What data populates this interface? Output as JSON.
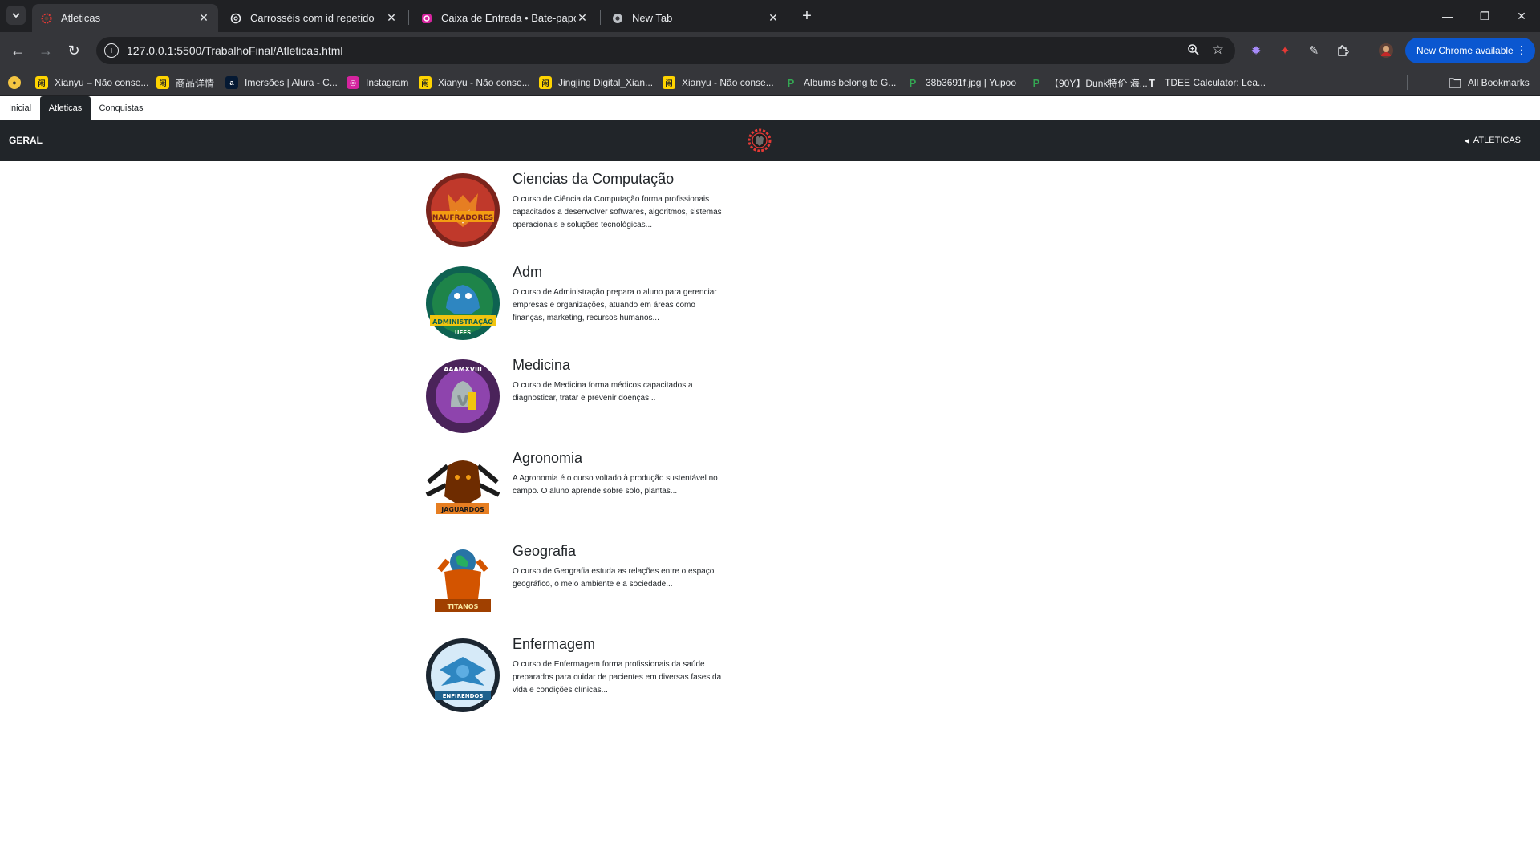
{
  "browser": {
    "tabs": [
      {
        "title": "Atleticas",
        "active": true,
        "icon": "atletica-favicon"
      },
      {
        "title": "Carrosséis com id repetido",
        "active": false,
        "icon": "openai-icon"
      },
      {
        "title": "Caixa de Entrada • Bate-papos",
        "active": false,
        "icon": "instagram-icon"
      },
      {
        "title": "New Tab",
        "active": false,
        "icon": "chrome-icon"
      }
    ],
    "url": "127.0.0.1:5500/TrabalhoFinal/Atleticas.html",
    "update_button": "New Chrome available",
    "bookmarks": [
      {
        "label": "",
        "icon": "bookmark-ufo-icon"
      },
      {
        "label": "Xianyu – Não conse...",
        "icon": "xianyu-icon"
      },
      {
        "label": "商品详情",
        "icon": "xianyu-icon"
      },
      {
        "label": "Imersões | Alura - C...",
        "icon": "alura-icon"
      },
      {
        "label": "Instagram",
        "icon": "instagram-icon"
      },
      {
        "label": "Xianyu - Não conse...",
        "icon": "xianyu-icon"
      },
      {
        "label": "Jingjing Digital_Xian...",
        "icon": "xianyu-icon"
      },
      {
        "label": "Xianyu - Não conse...",
        "icon": "xianyu-icon"
      },
      {
        "label": "Albums belong to G...",
        "icon": "yupoo-icon"
      },
      {
        "label": "38b3691f.jpg | Yupoo",
        "icon": "yupoo-icon"
      },
      {
        "label": "【90Y】Dunk特价 海...",
        "icon": "yupoo-icon"
      },
      {
        "label": "TDEE Calculator: Lea...",
        "icon": "tdee-icon"
      }
    ],
    "all_bookmarks": "All Bookmarks"
  },
  "page": {
    "tabs": [
      {
        "label": "Inicial",
        "active": false
      },
      {
        "label": "Atleticas",
        "active": true
      },
      {
        "label": "Conquistas",
        "active": false
      }
    ],
    "navbar": {
      "brand": "GERAL",
      "dropdown": "ATLETICAS"
    },
    "courses": [
      {
        "name": "Ciencias da Computação",
        "description": "O curso de Ciência da Computação forma profissionais capacitados a desenvolver softwares, algoritmos, sistemas operacionais e soluções tecnológicas...",
        "emblem_text": "NAUFRADORES",
        "emblem_color": "#c0392b"
      },
      {
        "name": "Adm",
        "description": "O curso de Administração prepara o aluno para gerenciar empresas e organizações, atuando em áreas como finanças, marketing, recursos humanos...",
        "emblem_text": "ADMINISTRAÇÃO",
        "emblem_color": "#1e8449"
      },
      {
        "name": "Medicina",
        "description": "O curso de Medicina forma médicos capacitados a diagnosticar, tratar e prevenir doenças...",
        "emblem_text": "AAAMXVIII",
        "emblem_color": "#6c3483"
      },
      {
        "name": "Agronomia",
        "description": "A Agronomia é o curso voltado à produção sustentável no campo. O aluno aprende sobre solo, plantas...",
        "emblem_text": "JAGUARDOS",
        "emblem_color": "#e67e22"
      },
      {
        "name": "Geografia",
        "description": "O curso de Geografia estuda as relações entre o espaço geográfico, o meio ambiente e a sociedade...",
        "emblem_text": "TITANOS",
        "emblem_color": "#a04000"
      },
      {
        "name": "Enfermagem",
        "description": "O curso de Enfermagem forma profissionais da saúde preparados para cuidar de pacientes em diversas fases da vida e condições clínicas...",
        "emblem_text": "ENFIRENDOS",
        "emblem_color": "#1f618d"
      }
    ]
  }
}
